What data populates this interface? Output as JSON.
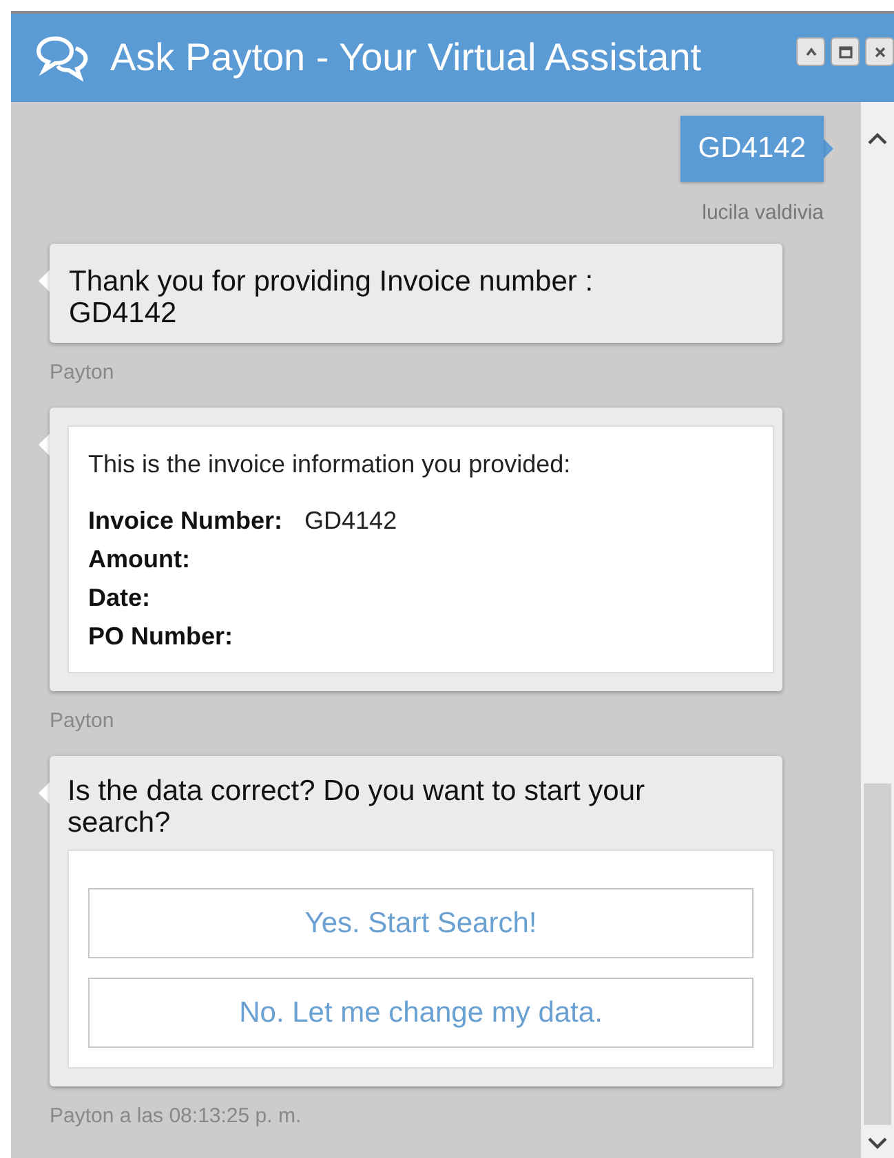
{
  "window": {
    "title": "Ask Payton - Your Virtual Assistant"
  },
  "messages": [
    {
      "kind": "user",
      "text": "GD4142",
      "sender": "lucila valdivia"
    },
    {
      "kind": "text",
      "text": "Thank you for providing Invoice number : GD4142",
      "sender": "Payton"
    },
    {
      "kind": "card",
      "intro": "This is the invoice information you provided:",
      "fields": [
        {
          "label": "Invoice Number:",
          "value": "GD4142"
        },
        {
          "label": "Amount:"
        },
        {
          "label": "Date:"
        },
        {
          "label": "PO Number:"
        }
      ],
      "sender": "Payton"
    },
    {
      "kind": "options",
      "text": "Is the data correct? Do you want to start your search?",
      "options": [
        "Yes. Start Search!",
        "No. Let me change my data."
      ],
      "sender": "Payton a las 08:13:25 p. m."
    }
  ]
}
